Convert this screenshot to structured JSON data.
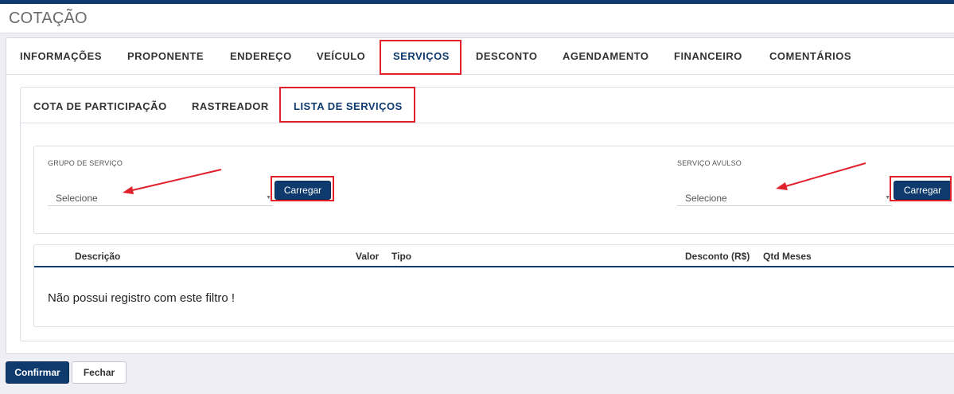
{
  "page": {
    "title": "COTAÇÃO"
  },
  "tabs": [
    {
      "label": "INFORMAÇÕES",
      "active": false
    },
    {
      "label": "PROPONENTE",
      "active": false
    },
    {
      "label": "ENDEREÇO",
      "active": false
    },
    {
      "label": "VEÍCULO",
      "active": false
    },
    {
      "label": "SERVIÇOS",
      "active": true
    },
    {
      "label": "DESCONTO",
      "active": false
    },
    {
      "label": "AGENDAMENTO",
      "active": false
    },
    {
      "label": "FINANCEIRO",
      "active": false
    },
    {
      "label": "COMENTÁRIOS",
      "active": false
    }
  ],
  "subtabs": [
    {
      "label": "COTA DE PARTICIPAÇÃO",
      "active": false
    },
    {
      "label": "RASTREADOR",
      "active": false
    },
    {
      "label": "LISTA DE SERVIÇOS",
      "active": true
    }
  ],
  "filters": {
    "grupo": {
      "label": "GRUPO DE SERVIÇO",
      "value": "Selecione",
      "button": "Carregar"
    },
    "avulso": {
      "label": "SERVIÇO AVULSO",
      "value": "Selecione",
      "button": "Carregar"
    }
  },
  "table": {
    "columns": [
      "Descrição",
      "Valor",
      "Tipo",
      "Desconto (R$)",
      "Qtd Meses"
    ],
    "empty_message": "Não possui registro com este filtro !"
  },
  "footer": {
    "confirm": "Confirmar",
    "close": "Fechar"
  },
  "colors": {
    "primary": "#0e3a6e",
    "highlight": "#e0202a"
  }
}
